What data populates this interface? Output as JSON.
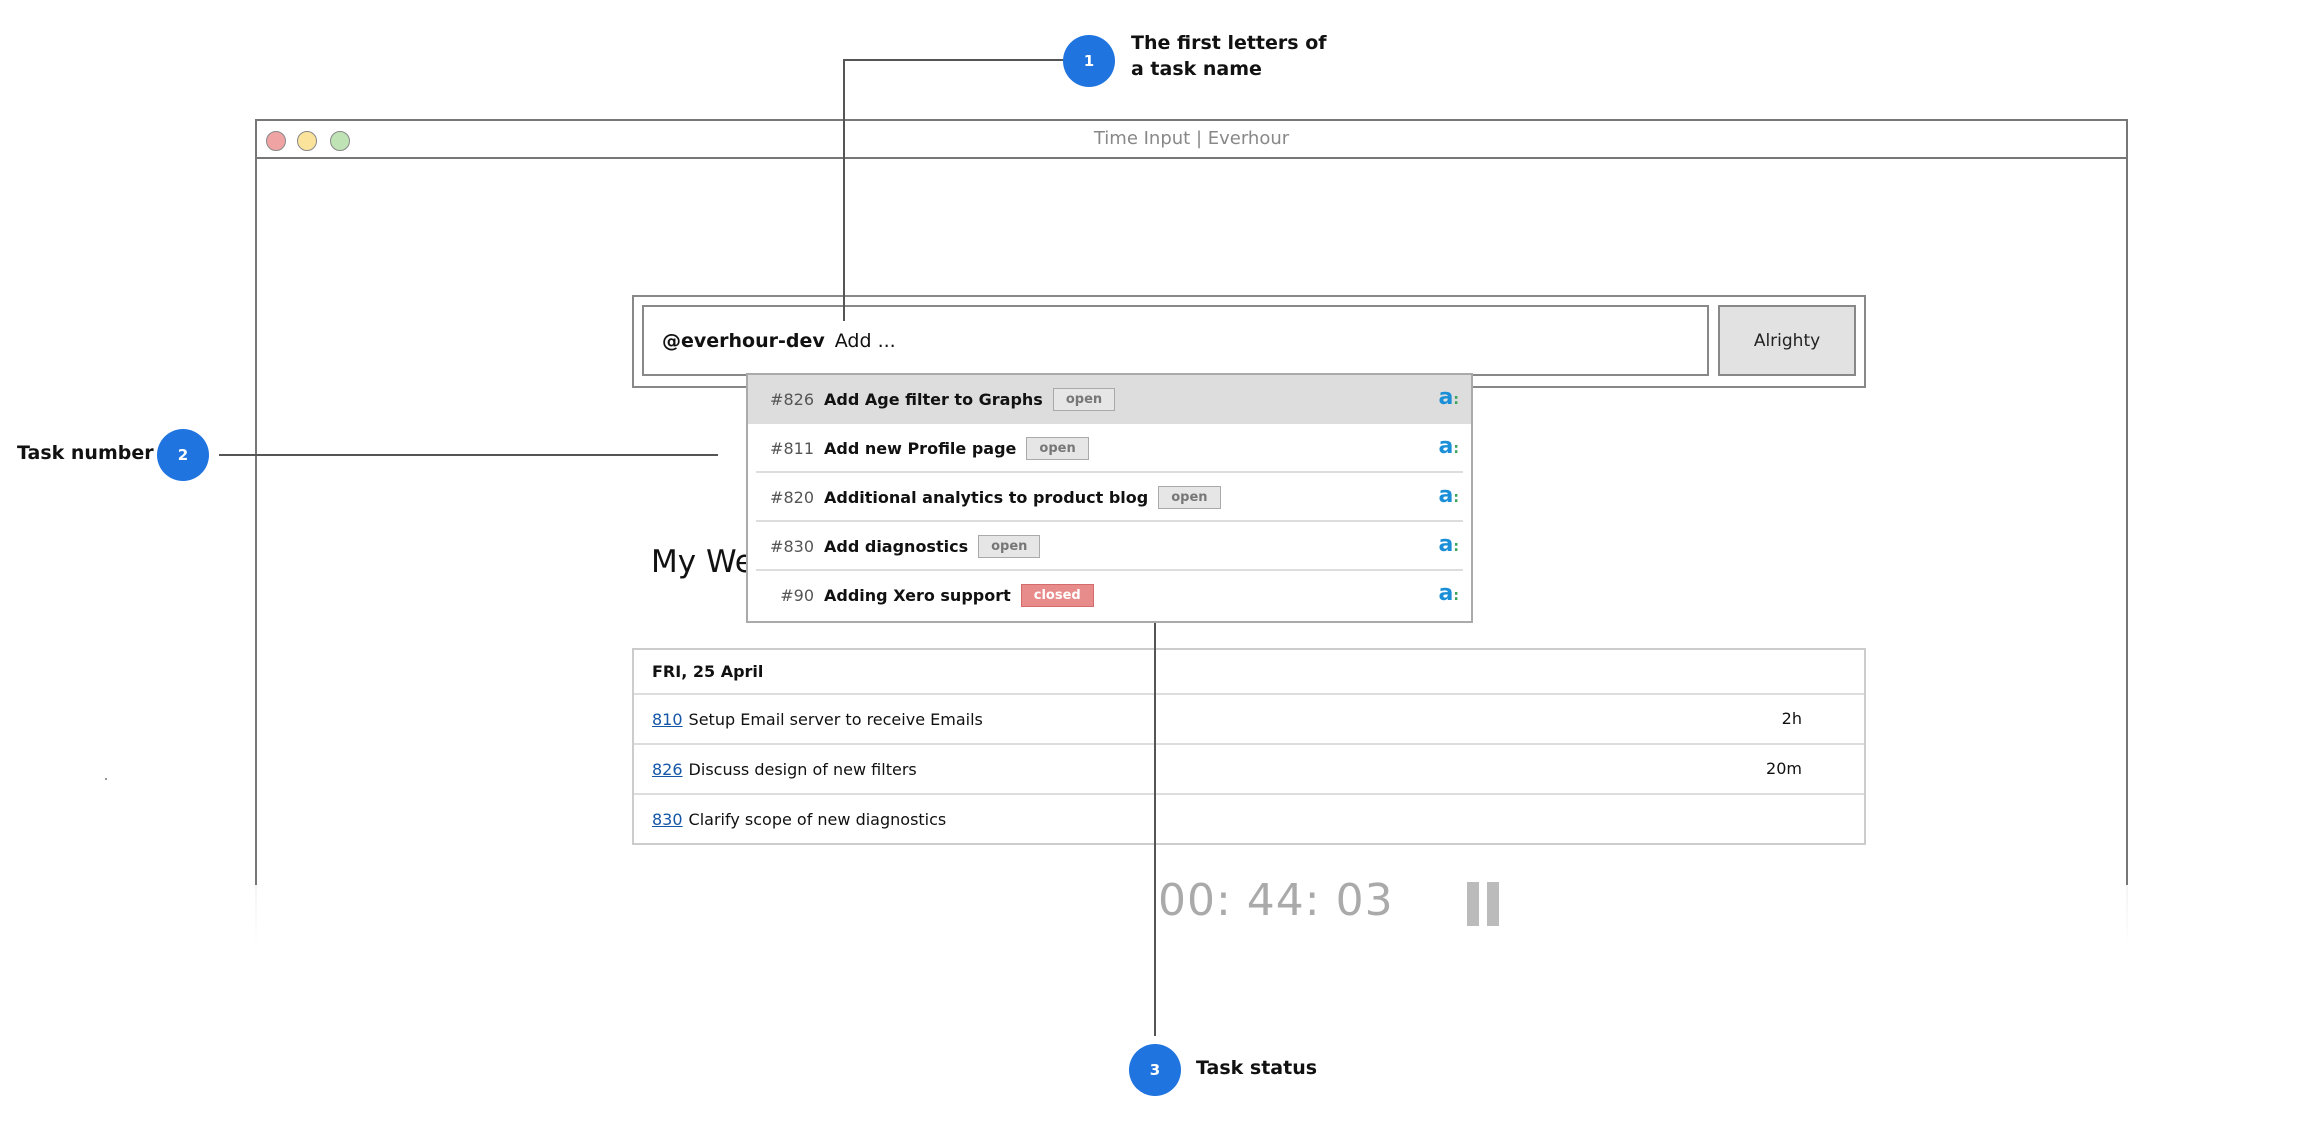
{
  "window": {
    "title": "Time Input | Everhour"
  },
  "input": {
    "prefix": "@everhour-dev",
    "value": "Add ..."
  },
  "submit_label": "Alrighty",
  "dropdown": [
    {
      "number": "#826",
      "name": "Add Age filter to Graphs",
      "status": "open",
      "highlighted": true
    },
    {
      "number": "#811",
      "name": "Add new Profile page",
      "status": "open"
    },
    {
      "number": "#820",
      "name": "Additional analytics to product blog",
      "status": "open"
    },
    {
      "number": "#830",
      "name": "Add diagnostics",
      "status": "open"
    },
    {
      "number": "#90",
      "name": "Adding Xero support",
      "status": "closed"
    }
  ],
  "week_title": "My We",
  "day": {
    "header": "FRI, 25 April",
    "rows": [
      {
        "id": "810",
        "text": "Setup Email server to receive Emails",
        "duration": "2h"
      },
      {
        "id": "826",
        "text": "Discuss design of new filters",
        "duration": "20m"
      },
      {
        "id": "830",
        "text": "Clarify scope of new diagnostics",
        "duration": ""
      }
    ]
  },
  "timer": "00: 44: 03",
  "annotations": [
    {
      "num": "1",
      "line1": "The first letters of",
      "line2": "a task name"
    },
    {
      "num": "2",
      "label": "Task number"
    },
    {
      "num": "3",
      "label": "Task status"
    }
  ],
  "colors": {
    "marker": "#1f74e0",
    "closed_badge": "#e88b8b",
    "link": "#1456a8"
  }
}
